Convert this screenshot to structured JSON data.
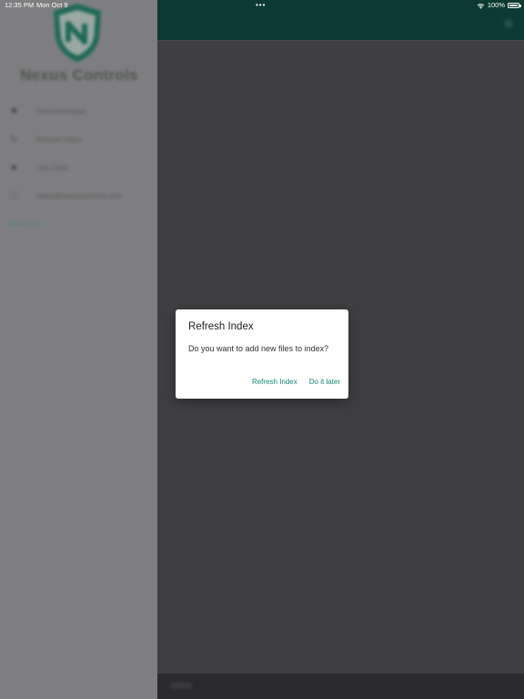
{
  "status_bar": {
    "time": "12:35 PM",
    "date": "Mon Oct 9",
    "dots": "•••",
    "battery": "100%",
    "wifi_icon": "wifi-icon",
    "battery_icon": "battery-full-icon"
  },
  "drawer": {
    "brand": "Nexus Controls",
    "logo_icon": "shield-logo-icon",
    "items": [
      {
        "icon": "close-icon",
        "label": "Documentation"
      },
      {
        "icon": "refresh-icon",
        "label": "Refresh Index"
      },
      {
        "icon": "square-icon",
        "label": "Live Chat"
      },
      {
        "icon": "info-icon",
        "label": "sales@nexuscontrols.com"
      }
    ],
    "extra": "Version 1.0"
  },
  "colors": {
    "accent": "#17887a",
    "header": "#0c3a30",
    "dialog_bg": "#ffffff"
  },
  "dialog": {
    "title": "Refresh Index",
    "message": "Do you want to add new files to index?",
    "primary_action": "Refresh Index",
    "secondary_action": "Do it later"
  }
}
